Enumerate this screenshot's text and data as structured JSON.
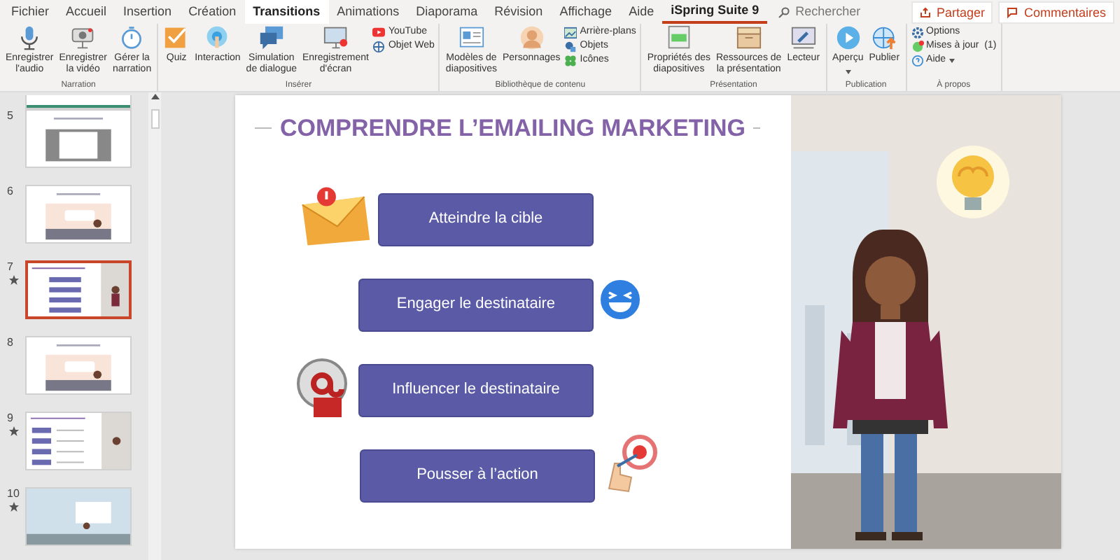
{
  "tabs": [
    {
      "label": "Fichier",
      "selected": false,
      "hover": false
    },
    {
      "label": "Accueil",
      "selected": false,
      "hover": false
    },
    {
      "label": "Insertion",
      "selected": false,
      "hover": false
    },
    {
      "label": "Création",
      "selected": false,
      "hover": false
    },
    {
      "label": "Transitions",
      "selected": false,
      "hover": true
    },
    {
      "label": "Animations",
      "selected": false,
      "hover": false
    },
    {
      "label": "Diaporama",
      "selected": false,
      "hover": false
    },
    {
      "label": "Révision",
      "selected": false,
      "hover": false
    },
    {
      "label": "Affichage",
      "selected": false,
      "hover": false
    },
    {
      "label": "Aide",
      "selected": false,
      "hover": false
    },
    {
      "label": "iSpring Suite 9",
      "selected": true,
      "hover": false
    }
  ],
  "search": {
    "placeholder": "Rechercher"
  },
  "actions": [
    {
      "label": "Partager",
      "kind": "share"
    },
    {
      "label": "Commentaires",
      "kind": "comment"
    }
  ],
  "ribbon_groups": [
    {
      "label": "Narration",
      "items": [
        {
          "kind": "large",
          "lines": [
            "Enregistrer",
            "l'audio"
          ]
        },
        {
          "kind": "large",
          "lines": [
            "Enregistrer",
            "la vidéo"
          ]
        },
        {
          "kind": "large",
          "lines": [
            "Gérer la",
            "narration"
          ]
        }
      ]
    },
    {
      "label": "Insérer",
      "items": [
        {
          "kind": "large",
          "lines": [
            "Quiz"
          ]
        },
        {
          "kind": "large",
          "lines": [
            "Interaction"
          ]
        },
        {
          "kind": "large",
          "lines": [
            "Simulation",
            "de dialogue"
          ]
        },
        {
          "kind": "large",
          "lines": [
            "Enregistrement",
            "d'écran"
          ]
        },
        {
          "kind": "stack",
          "items": [
            {
              "label": "YouTube"
            },
            {
              "label": "Objet Web"
            }
          ]
        }
      ]
    },
    {
      "label": "Bibliothèque de contenu",
      "items": [
        {
          "kind": "large",
          "lines": [
            "Modèles de",
            "diapositives"
          ]
        },
        {
          "kind": "large",
          "lines": [
            "Personnages"
          ]
        },
        {
          "kind": "stack",
          "items": [
            {
              "label": "Arrière-plans"
            },
            {
              "label": "Objets"
            },
            {
              "label": "Icônes"
            }
          ]
        }
      ]
    },
    {
      "label": "Présentation",
      "items": [
        {
          "kind": "large",
          "lines": [
            "Propriétés des",
            "diapositives"
          ]
        },
        {
          "kind": "large",
          "lines": [
            "Ressources de",
            "la présentation"
          ]
        },
        {
          "kind": "large",
          "lines": [
            "Lecteur"
          ]
        }
      ]
    },
    {
      "label": "Publication",
      "items": [
        {
          "kind": "large",
          "lines": [
            "Aperçu"
          ],
          "dropdown": true
        },
        {
          "kind": "large",
          "lines": [
            "Publier"
          ]
        }
      ]
    },
    {
      "label": "À propos",
      "items": [
        {
          "kind": "stack",
          "items": [
            {
              "label": "Options"
            },
            {
              "label": "Mises à jour",
              "count": "(1)"
            },
            {
              "label": "Aide",
              "dropdown": true
            }
          ]
        }
      ]
    }
  ],
  "thumbnails": [
    {
      "kind": "teal",
      "selected": false,
      "animated": false
    },
    {
      "number": "5",
      "kind": "interaction",
      "selected": false,
      "animated": false
    },
    {
      "number": "6",
      "kind": "office",
      "selected": false,
      "animated": false
    },
    {
      "number": "7",
      "kind": "buttons",
      "selected": true,
      "animated": true
    },
    {
      "number": "8",
      "kind": "office",
      "selected": false,
      "animated": false
    },
    {
      "number": "9",
      "kind": "list",
      "selected": false,
      "animated": true
    },
    {
      "number": "10",
      "kind": "room",
      "selected": false,
      "animated": true
    }
  ],
  "slide": {
    "title": "COMPRENDRE L’EMAILING MARKETING",
    "items": [
      {
        "label": "Atteindre la cible"
      },
      {
        "label": "Engager le destinataire"
      },
      {
        "label": "Influencer le destinataire"
      },
      {
        "label": "Pousser à l’action"
      }
    ]
  }
}
